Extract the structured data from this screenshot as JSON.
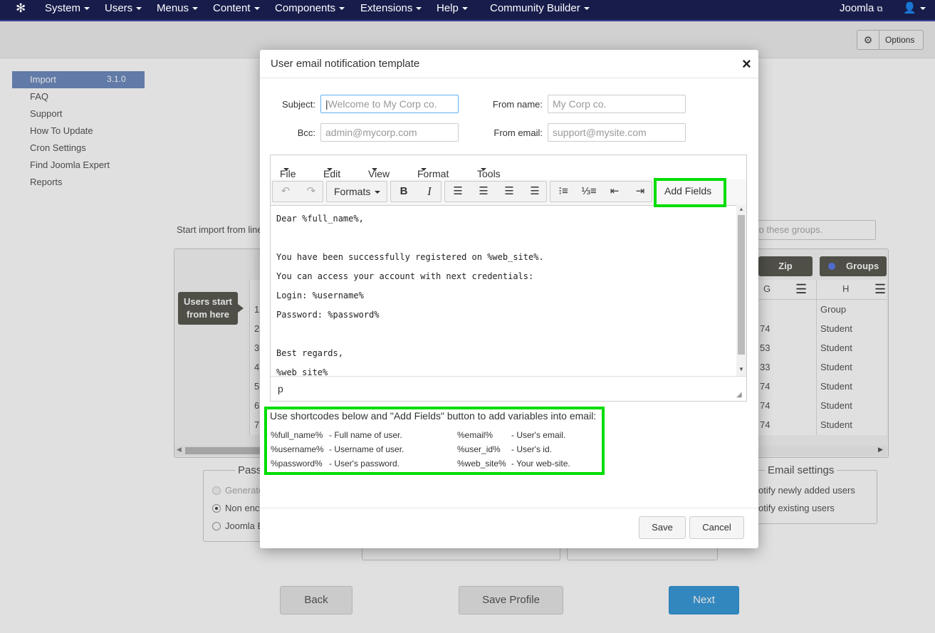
{
  "topnav": {
    "items": [
      "System",
      "Users",
      "Menus",
      "Content",
      "Components",
      "Extensions",
      "Help",
      "Community Builder"
    ],
    "site_link": "Joomla",
    "user_icon": "user-icon"
  },
  "toolbar": {
    "options_label": "Options"
  },
  "sidebar": {
    "items": [
      {
        "label": "Import",
        "badge": "3.1.0"
      },
      {
        "label": "FAQ"
      },
      {
        "label": "Support"
      },
      {
        "label": "How To Update"
      },
      {
        "label": "Cron Settings"
      },
      {
        "label": "Find Joomla Expert"
      },
      {
        "label": "Reports"
      }
    ]
  },
  "background": {
    "start_import_label": "Start import from line",
    "groups_placeholder": "to these groups.",
    "users_start_label": "Users start from here",
    "columns": [
      {
        "title": "Zip",
        "letter": "G"
      },
      {
        "title": "Groups",
        "letter": "H"
      }
    ],
    "row_numbers": [
      "1",
      "2",
      "3",
      "4",
      "5",
      "6",
      "7"
    ],
    "zip_values": [
      "",
      "74",
      "53",
      "33",
      "74",
      "74",
      "74"
    ],
    "group_values": [
      "Group",
      "Student",
      "Student",
      "Student",
      "Student",
      "Student",
      "Student"
    ],
    "password_legend": "Passw",
    "password_options": [
      "Generate",
      "Non enc",
      "Joomla E"
    ],
    "email_settings_legend": "Email settings",
    "email_options": [
      "otify newly added users",
      "otify existing users"
    ],
    "nav_buttons": {
      "back": "Back",
      "save_profile": "Save Profile",
      "next": "Next"
    }
  },
  "modal": {
    "title": "User email notification template",
    "close": "×",
    "subject_label": "Subject:",
    "subject_placeholder": "Welcome to My Corp co.",
    "from_name_label": "From name:",
    "from_name_placeholder": "My Corp co.",
    "bcc_label": "Bcc:",
    "bcc_placeholder": "admin@mycorp.com",
    "from_email_label": "From email:",
    "from_email_placeholder": "support@mysite.com",
    "editor": {
      "menus": [
        "File",
        "Edit",
        "View",
        "Format",
        "Tools"
      ],
      "formats_label": "Formats",
      "add_fields_label": "Add Fields",
      "body_lines": [
        "Dear %full_name%,",
        "",
        "You have been successfully registered on %web_site%.",
        "You can access your account with next credentials:",
        "Login: %username%",
        "Password: %password%",
        "",
        "Best regards,",
        "%web_site%"
      ],
      "status_path": "p"
    },
    "shortcodes_title": "Use shortcodes below and \"Add Fields\" button to add variables into email:",
    "shortcodes": [
      {
        "code": "%full_name%",
        "desc": "- Full name of user."
      },
      {
        "code": "%username%",
        "desc": "- Username of user."
      },
      {
        "code": "%password%",
        "desc": "- User's password."
      },
      {
        "code": "%email%",
        "desc": "- User's email."
      },
      {
        "code": "%user_id%",
        "desc": "- User's id."
      },
      {
        "code": "%web_site%",
        "desc": "- Your web-site."
      }
    ],
    "save_label": "Save",
    "cancel_label": "Cancel"
  },
  "colors": {
    "topbar": "#171c4b",
    "sidebar_active": "#6f8bbf",
    "highlight": "#00dd00",
    "next_button": "#3a9ad9"
  }
}
